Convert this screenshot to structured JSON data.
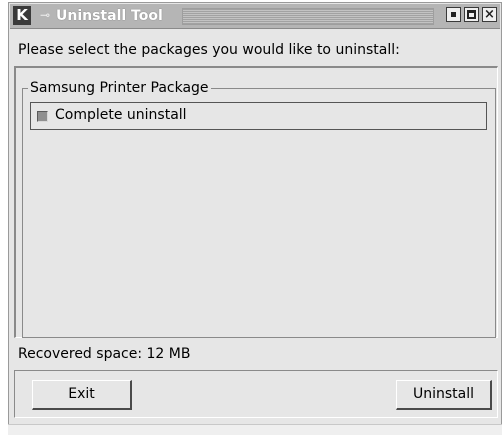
{
  "window": {
    "title": "Uninstall Tool",
    "icons": [
      "k-logo-icon",
      "pin-icon",
      "minimize-icon",
      "maximize-icon",
      "close-icon"
    ]
  },
  "instruction": "Please select the packages you would like to uninstall:",
  "group": {
    "label": "Samsung Printer Package",
    "options": [
      {
        "label": "Complete uninstall",
        "checked": false
      }
    ]
  },
  "recovered": {
    "label": "Recovered space:",
    "value": "12 MB"
  },
  "buttons": {
    "exit": "Exit",
    "uninstall": "Uninstall"
  },
  "titlebar_glyphs": {
    "logo": "K",
    "close": "×"
  }
}
